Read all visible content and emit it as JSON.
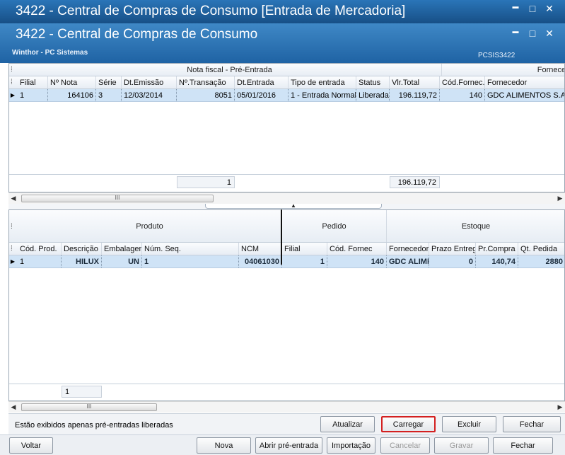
{
  "outer_title": "3422 - Central de Compras de Consumo [Entrada de Mercadoria]",
  "inner_title": "3422 - Central de Compras de Consumo",
  "subtitle": "Winthor - PC Sistemas",
  "routine_code": "PCSIS3422",
  "window_buttons": {
    "minimize": "▬",
    "restore": "□",
    "close": "✕"
  },
  "nf_grid": {
    "group_headers": [
      "Nota fiscal - Pré-Entrada",
      "Fornecedor"
    ],
    "columns": [
      "Filial",
      "Nº Nota",
      "Série",
      "Dt.Emissão",
      "Nº.Transação",
      "Dt.Entrada",
      "Tipo de entrada",
      "Status",
      "Vlr.Total",
      "Cód.Fornec.",
      "Fornecedor"
    ],
    "rows": [
      [
        "1",
        "164106",
        "3",
        "12/03/2014",
        "8051",
        "05/01/2016",
        "1 - Entrada Normal",
        "Liberada",
        "196.119,72",
        "140",
        "GDC ALIMENTOS S.A."
      ]
    ],
    "footer": {
      "transacao_count": "1",
      "vlr_total": "196.119,72"
    },
    "scroll_marker": "III"
  },
  "prod_grid": {
    "group_headers": [
      "Produto",
      "Pedido",
      "Estoque"
    ],
    "columns": [
      "Cód. Prod.",
      "Descrição",
      "Embalagem",
      "Núm. Seq.",
      "NCM",
      "Filial",
      "Cód. Fornec",
      "Fornecedor",
      "Prazo Entrega",
      "Pr.Compra",
      "Qt. Pedida"
    ],
    "rows": [
      [
        "1",
        "HILUX",
        "UN",
        "1",
        "04061030",
        "1",
        "140",
        "GDC ALIMENTOS S.A.",
        "0",
        "140,74",
        "2880"
      ]
    ],
    "footer": {
      "count": "1"
    },
    "scroll_marker": "III"
  },
  "status_message": "Estão exibidos apenas pré-entradas liberadas",
  "panel_buttons": {
    "atualizar": "Atualizar",
    "carregar": "Carregar",
    "excluir": "Excluir",
    "fechar": "Fechar"
  },
  "bottom_buttons": {
    "voltar": "Voltar",
    "nova": "Nova",
    "abrir": "Abrir pré-entrada",
    "importacao": "Importação",
    "cancelar": "Cancelar",
    "gravar": "Gravar",
    "fechar": "Fechar"
  },
  "colors": {
    "title_dark": "#174f86",
    "title_light": "#3f88c6",
    "selected_row": "#cfe3f6",
    "highlight_border": "#d32020"
  }
}
